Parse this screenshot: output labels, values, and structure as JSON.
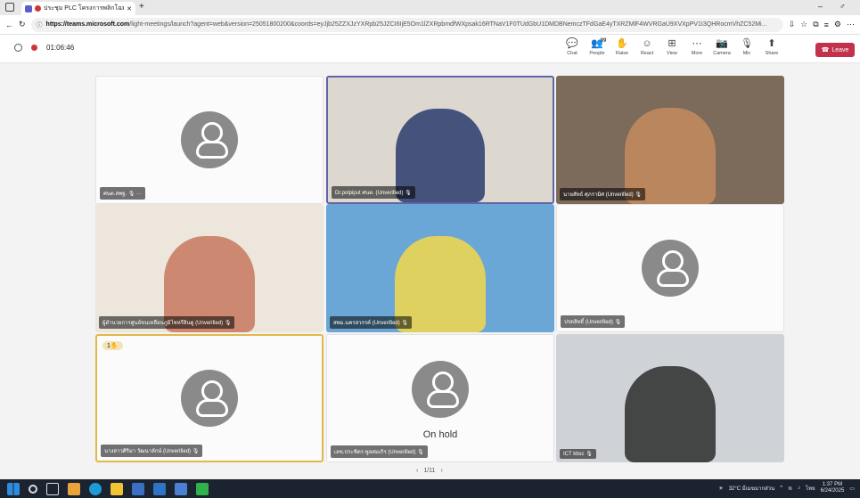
{
  "browser": {
    "tab_title": "ประชุม PLC โครงการพลิกโฉมโรงฯ",
    "url_host": "https://teams.microsoft.com",
    "url_path": "/light-meetings/launch?agent=web&version=25051800200&coords=eyJjb25ZZXJzYXRpb25JZCI6IjE5Om1lZXRpbmdfWXpsak16RTNaV1F0TUdGbU1DMDBNemczTFdGaE4yTXRZMlF4WVRGaU9XVXpPV1I3QHRocmVhZC52Mi..."
  },
  "meeting": {
    "timer": "01:06:46",
    "controls": [
      {
        "label": "Chat",
        "icon": "chat-icon",
        "glyph": "💬"
      },
      {
        "label": "People",
        "icon": "people-icon",
        "glyph": "👥",
        "badge": "99"
      },
      {
        "label": "Raise",
        "icon": "raise-hand-icon",
        "glyph": "✋"
      },
      {
        "label": "React",
        "icon": "react-icon",
        "glyph": "☺"
      },
      {
        "label": "View",
        "icon": "view-icon",
        "glyph": "⊞"
      },
      {
        "label": "More",
        "icon": "more-icon",
        "glyph": "⋯"
      },
      {
        "label": "Camera",
        "icon": "camera-icon",
        "glyph": "📷"
      },
      {
        "label": "Mic",
        "icon": "mic-icon",
        "glyph": "🎙"
      },
      {
        "label": "Share",
        "icon": "share-icon",
        "glyph": "⬆"
      }
    ],
    "leave_label": "Leave"
  },
  "participants": [
    {
      "name": "ศนต.สพฐ. 🎙 ···",
      "type": "avatar"
    },
    {
      "name": "Dr.polpiput ศนต. (Unverified) 🎙",
      "type": "video",
      "bg": "#dcd7cf",
      "fg": "#2a3b6c"
    },
    {
      "name": "นายสัทธ์ ศุภรามิศ (Unverified) 🎙",
      "type": "video",
      "bg": "#7c6a5a",
      "fg": "#c58b5f"
    },
    {
      "name": "ผู้อำนวยการศูนย์ขนเหลือนภูมิไชหรีอินดู (Unverified) 🎙",
      "type": "video",
      "bg": "#ece6dc",
      "fg": "#c7775d"
    },
    {
      "name": "สพม.นครสวรรค์ (Unverified) 🎙",
      "type": "video",
      "bg": "#6aa7d6",
      "fg": "#f2d84a"
    },
    {
      "name": "ปรดลิทธิ์ (Unverified) 🎙",
      "type": "avatar"
    },
    {
      "name": "นางสาวศิริมา วัฒนาลักษ์ (Unverified) 🎙",
      "type": "avatar",
      "hand": "1✋"
    },
    {
      "name": "เลข.ประชิตร พูลสมเกิร (Unverified) 🎙",
      "type": "avatar",
      "hold": "On hold"
    },
    {
      "name": "ICT kbsc 🎙",
      "type": "video",
      "bg": "#cfd3d8",
      "fg": "#2b2b2b"
    }
  ],
  "pager": {
    "prev": "‹",
    "label": "1/11",
    "next": "›"
  },
  "taskbar": {
    "weather": "32°C มีเมฆมากส่วน",
    "lang": "ไทย",
    "time": "1:37 PM",
    "date": "6/24/2025"
  }
}
